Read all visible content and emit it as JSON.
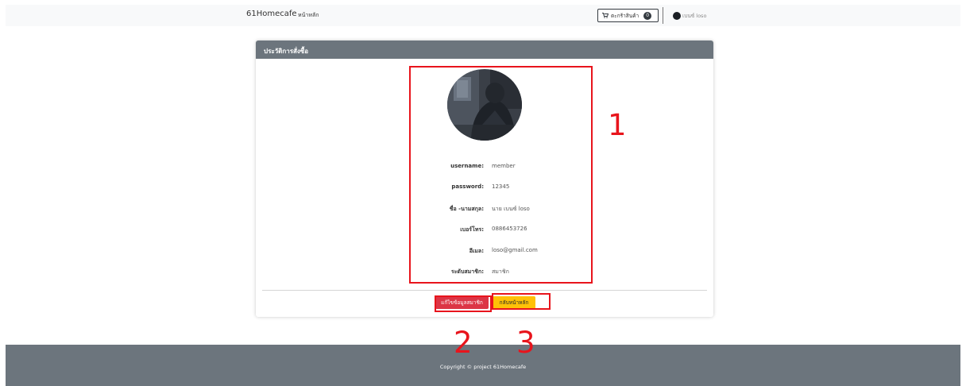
{
  "navbar": {
    "brand": "61Homecafe",
    "home_link": "หน้าหลัก",
    "cart_label": "ตะกร้าสินค้า",
    "cart_count": "0",
    "user_name": "เบนซ์ loso"
  },
  "card": {
    "title": "ประวัติการสั่งซื้อ",
    "fields": [
      {
        "label": "username:",
        "value": "member"
      },
      {
        "label": "password:",
        "value": "12345"
      },
      {
        "label": "ชื่อ -นามสกุล:",
        "value": "นาย เบนซ์ loso"
      },
      {
        "label": "เบอร์โทร:",
        "value": "0886453726"
      },
      {
        "label": "อีเมล:",
        "value": "loso@gmail.com"
      },
      {
        "label": "ระดับสมาชิก:",
        "value": "สมาชิก"
      }
    ],
    "edit_button": "แก้ไขข้อมูลสมาชิก",
    "home_button": "กลับหน้าหลัก"
  },
  "footer": {
    "copyright": "Copyright © project 61Homecafe"
  },
  "annotations": [
    "1",
    "2",
    "3"
  ],
  "colors": {
    "header_gray": "#6c757d",
    "navbar_bg": "#f8f9fa",
    "danger": "#dc3545",
    "warning": "#ffc107",
    "annotation_red": "#e8141c"
  },
  "icons": {
    "cart": "shopping-cart-icon",
    "user": "user-avatar-icon"
  }
}
